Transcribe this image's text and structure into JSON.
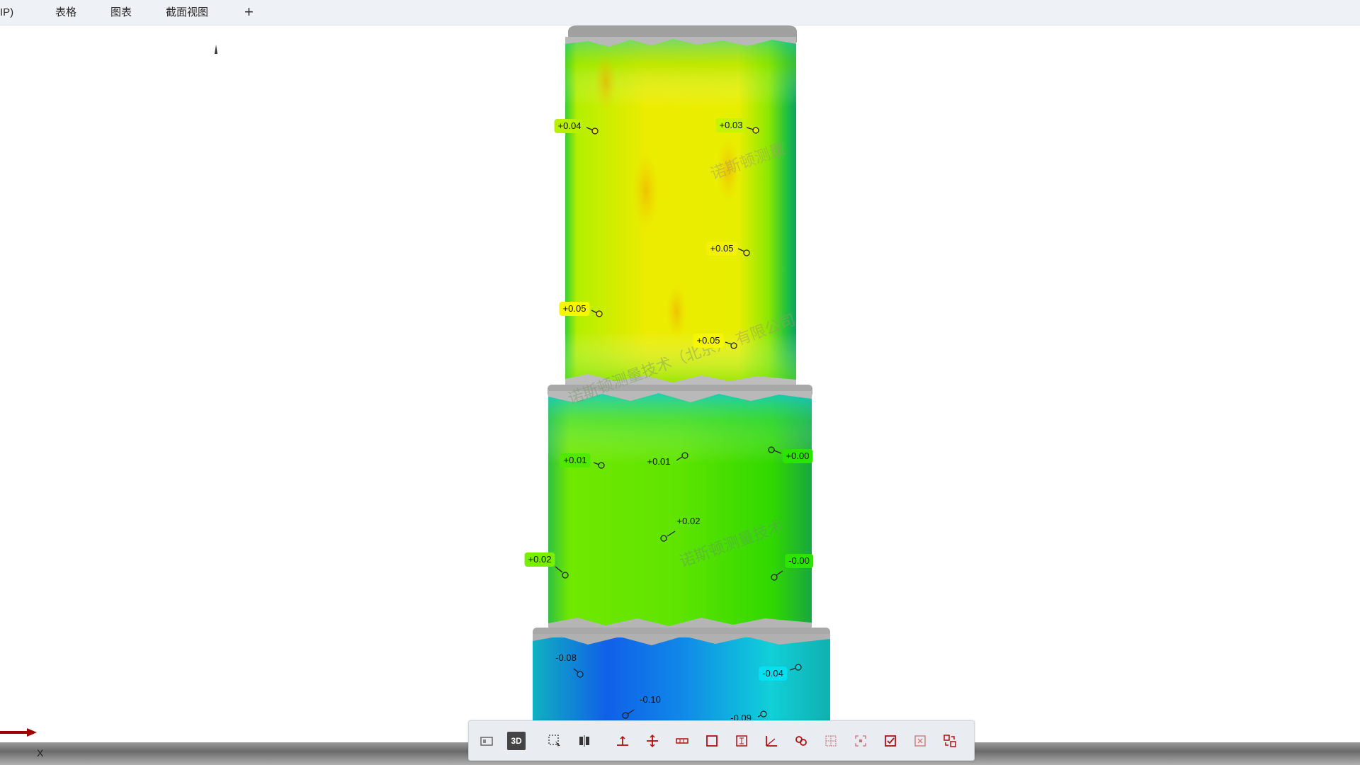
{
  "tabs": [
    {
      "label": "IP)"
    },
    {
      "label": "表格"
    },
    {
      "label": "图表"
    },
    {
      "label": "截面视图"
    },
    {
      "label": "+"
    }
  ],
  "watermark": [
    "诺斯顿测量",
    "有限公司",
    "诺斯顿测量技术（北京）",
    "诺斯顿测量技术"
  ],
  "callouts": [
    {
      "text": "+0.04",
      "color": "#b8f000"
    },
    {
      "text": "+0.03",
      "color": "#c4f400"
    },
    {
      "text": "+0.05",
      "color": "#f2f200"
    },
    {
      "text": "+0.05",
      "color": "#f6f600"
    },
    {
      "text": "+0.05",
      "color": "#f6f600"
    },
    {
      "text": "+0.01",
      "color": "#50e800"
    },
    {
      "text": "+0.01",
      "color": ""
    },
    {
      "text": "+0.00",
      "color": "#2ce400"
    },
    {
      "text": "+0.02",
      "color": ""
    },
    {
      "text": "+0.02",
      "color": "#78ee00"
    },
    {
      "text": "-0.00",
      "color": "#2ce400"
    },
    {
      "text": "-0.08",
      "color": ""
    },
    {
      "text": "-0.04",
      "color": "#00e0f0"
    },
    {
      "text": "-0.10",
      "color": ""
    },
    {
      "text": "-0.09",
      "color": ""
    }
  ],
  "axis": {
    "x_label": "X"
  },
  "toolbar": {
    "buttons": [
      {
        "name": "view-2d-icon"
      },
      {
        "name": "view-3d-icon",
        "label": "3D"
      },
      {
        "name": "select-area-icon"
      },
      {
        "name": "split-view-icon"
      },
      {
        "name": "point-annotate-icon"
      },
      {
        "name": "cross-section-icon"
      },
      {
        "name": "measure-icon"
      },
      {
        "name": "frame-icon"
      },
      {
        "name": "dimension-icon"
      },
      {
        "name": "angle-icon"
      },
      {
        "name": "link-icon"
      },
      {
        "name": "grid-select-icon"
      },
      {
        "name": "fit-view-icon"
      },
      {
        "name": "check-icon"
      },
      {
        "name": "close-box-icon"
      },
      {
        "name": "swap-icon"
      }
    ]
  }
}
